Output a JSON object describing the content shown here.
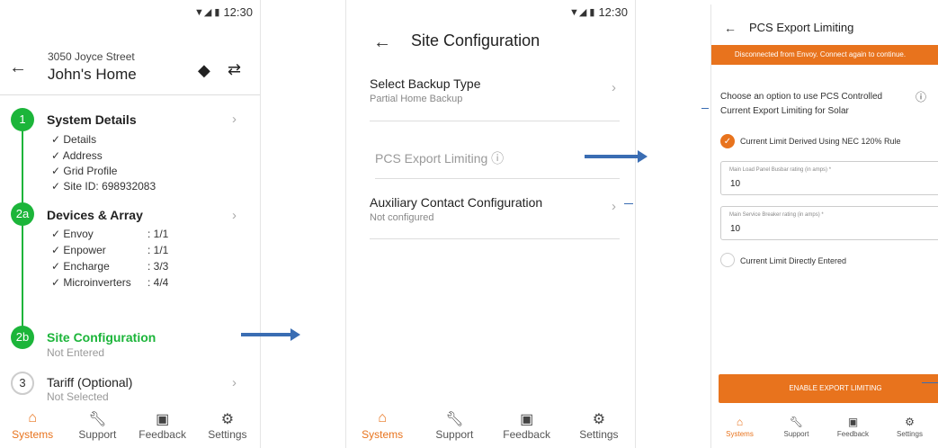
{
  "status": {
    "time": "12:30"
  },
  "screen1": {
    "address": "3050 Joyce Street",
    "home": "John's Home",
    "steps": {
      "s1": "1",
      "s2a": "2a",
      "s2b": "2b",
      "s3": "3"
    },
    "system_details": {
      "title": "System Details",
      "checks": [
        "✓ Details",
        "✓ Address",
        "✓ Grid Profile",
        "✓ Site ID: 698932083"
      ]
    },
    "devices": {
      "title": "Devices & Array",
      "rows": [
        {
          "name": "✓ Envoy",
          "count": ": 1/1"
        },
        {
          "name": "✓ Enpower",
          "count": ": 1/1"
        },
        {
          "name": "✓ Encharge",
          "count": ": 3/3"
        },
        {
          "name": "✓ Microinverters",
          "count": ": 4/4"
        }
      ]
    },
    "site_config": {
      "title": "Site Configuration",
      "sub": "Not Entered"
    },
    "tariff": {
      "title": "Tariff (Optional)",
      "sub": "Not Selected"
    }
  },
  "tabs": [
    "Systems",
    "Support",
    "Feedback",
    "Settings"
  ],
  "screen2": {
    "title": "Site Configuration",
    "items": [
      {
        "label": "Select Backup Type",
        "sub": "Partial Home Backup"
      },
      {
        "label": "PCS Export Limiting ⓘ",
        "sub": ""
      },
      {
        "label": "Auxiliary Contact Configuration",
        "sub": "Not configured"
      }
    ]
  },
  "screen3": {
    "title": "PCS Export Limiting",
    "banner": "Disconnected from Envoy. Connect again to continue.",
    "prompt": "Choose an option to use PCS Controlled Current Export Limiting for Solar",
    "option1": "Current Limit Derived Using NEC 120% Rule",
    "field1_label": "Main Load Panel Busbar rating (in amps) *",
    "field1_value": "10",
    "field2_label": "Main Service Breaker rating (in amps) *",
    "field2_value": "10",
    "option2": "Current Limit Directly Entered",
    "button": "ENABLE EXPORT LIMITING"
  },
  "colors": {
    "accent": "#e8731d",
    "green": "#1cb53a",
    "arrow": "#3a6db3"
  }
}
